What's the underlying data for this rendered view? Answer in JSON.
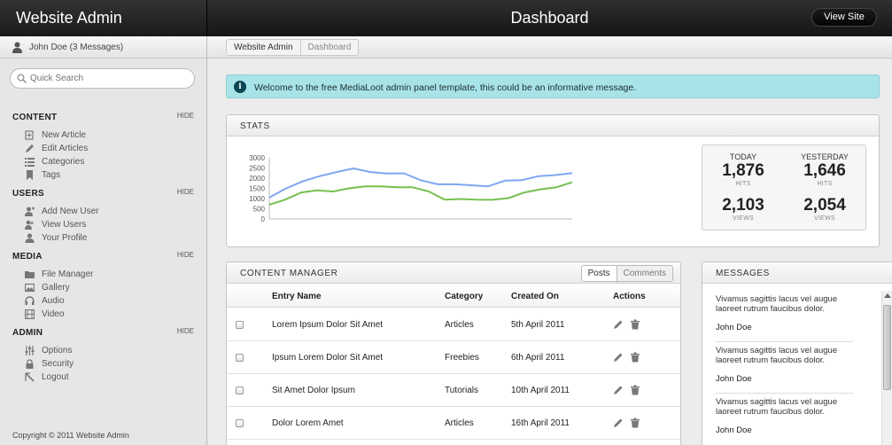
{
  "header": {
    "brand": "Website Admin",
    "title": "Dashboard",
    "view_site": "View Site"
  },
  "user": {
    "label": "John Doe (3 Messages)"
  },
  "breadcrumb": [
    "Website Admin",
    "Dashboard"
  ],
  "search": {
    "placeholder": "Quick Search"
  },
  "sidebar": {
    "sections": [
      {
        "title": "CONTENT",
        "hide": "HIDE",
        "items": [
          {
            "label": "New Article",
            "icon": "new-article-icon"
          },
          {
            "label": "Edit Articles",
            "icon": "pencil-icon"
          },
          {
            "label": "Categories",
            "icon": "list-icon"
          },
          {
            "label": "Tags",
            "icon": "tag-icon"
          }
        ]
      },
      {
        "title": "USERS",
        "hide": "HIDE",
        "items": [
          {
            "label": "Add New User",
            "icon": "add-user-icon"
          },
          {
            "label": "View Users",
            "icon": "users-icon"
          },
          {
            "label": "Your Profile",
            "icon": "user-icon"
          }
        ]
      },
      {
        "title": "MEDIA",
        "hide": "HIDE",
        "items": [
          {
            "label": "File Manager",
            "icon": "folder-icon"
          },
          {
            "label": "Gallery",
            "icon": "gallery-icon"
          },
          {
            "label": "Audio",
            "icon": "audio-icon"
          },
          {
            "label": "Video",
            "icon": "video-icon"
          }
        ]
      },
      {
        "title": "ADMIN",
        "hide": "HIDE",
        "items": [
          {
            "label": "Options",
            "icon": "sliders-icon"
          },
          {
            "label": "Security",
            "icon": "lock-icon"
          },
          {
            "label": "Logout",
            "icon": "logout-icon"
          }
        ]
      }
    ],
    "copyright": "Copyright © 2011 Website Admin"
  },
  "alert": {
    "message": "Welcome to the free MediaLoot admin panel template, this could be an informative message."
  },
  "stats": {
    "title": "STATS",
    "today": {
      "label": "TODAY",
      "hits": "1,876",
      "views": "2,103"
    },
    "yesterday": {
      "label": "YESTERDAY",
      "hits": "1,646",
      "views": "2,054"
    },
    "hits_label": "HITS",
    "views_label": "VIEWS"
  },
  "chart_data": {
    "type": "line",
    "y_ticks": [
      "3000",
      "2500",
      "2000",
      "1500",
      "1000",
      "500",
      "0"
    ],
    "ylim": [
      0,
      3000
    ],
    "series": [
      {
        "color": "#7fa6f0",
        "values": [
          1050,
          1500,
          1850,
          2100,
          2300,
          2480,
          2300,
          2230,
          2240,
          1900,
          1700,
          1700,
          1650,
          1600,
          1880,
          1900,
          2100,
          2150,
          2250
        ]
      },
      {
        "color": "#76c04f",
        "values": [
          700,
          950,
          1300,
          1400,
          1350,
          1500,
          1600,
          1600,
          1550,
          1550,
          1350,
          950,
          980,
          950,
          940,
          1020,
          1300,
          1450,
          1550,
          1800
        ]
      }
    ]
  },
  "content_manager": {
    "title": "CONTENT MANAGER",
    "tabs": [
      "Posts",
      "Comments"
    ],
    "columns": [
      "Entry Name",
      "Category",
      "Created On",
      "Actions"
    ],
    "rows": [
      {
        "name": "Lorem Ipsum Dolor Sit Amet",
        "category": "Articles",
        "date": "5th April 2011"
      },
      {
        "name": "Ipsum Lorem Dolor Sit Amet",
        "category": "Freebies",
        "date": "6th April 2011"
      },
      {
        "name": "Sit Amet Dolor Ipsum",
        "category": "Tutorials",
        "date": "10th April 2011"
      },
      {
        "name": "Dolor Lorem Amet",
        "category": "Articles",
        "date": "16th April 2011"
      }
    ]
  },
  "messages": {
    "title": "MESSAGES",
    "items": [
      {
        "text": "Vivamus sagittis lacus vel augue laoreet rutrum faucibus dolor.",
        "author": "John Doe"
      },
      {
        "text": "Vivamus sagittis lacus vel augue laoreet rutrum faucibus dolor.",
        "author": "John Doe"
      },
      {
        "text": "Vivamus sagittis lacus vel augue laoreet rutrum faucibus dolor.",
        "author": "John Doe"
      }
    ]
  }
}
